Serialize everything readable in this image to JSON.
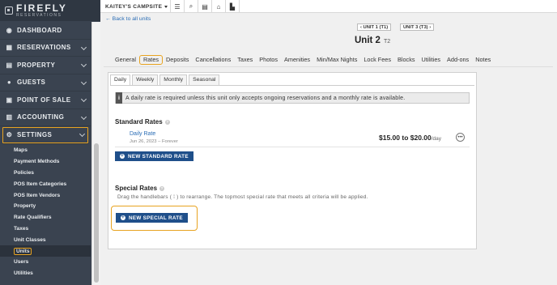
{
  "logo": {
    "name": "FIREFLY",
    "tagline": "RESERVATIONS"
  },
  "nav": [
    {
      "label": "DASHBOARD",
      "icon": "dashboard-icon",
      "glyph": "◉",
      "chevron": false
    },
    {
      "label": "RESERVATIONS",
      "icon": "calendar-icon",
      "glyph": "▦",
      "chevron": true
    },
    {
      "label": "PROPERTY",
      "icon": "building-icon",
      "glyph": "▤",
      "chevron": true
    },
    {
      "label": "GUESTS",
      "icon": "user-icon",
      "glyph": "●",
      "chevron": true
    },
    {
      "label": "POINT OF SALE",
      "icon": "cart-icon",
      "glyph": "▣",
      "chevron": true
    },
    {
      "label": "ACCOUNTING",
      "icon": "calculator-icon",
      "glyph": "▥",
      "chevron": true
    },
    {
      "label": "SETTINGS",
      "icon": "gear-icon",
      "glyph": "⚙",
      "chevron": true
    }
  ],
  "subnav": [
    "Maps",
    "Payment Methods",
    "Policies",
    "POS Item Categories",
    "POS Item Vendors",
    "Property",
    "Rate Qualifiers",
    "Taxes",
    "Unit Classes",
    "Units",
    "Users",
    "Utilities"
  ],
  "topbar": {
    "campsite": "KAITEY'S CAMPSITE",
    "icons": [
      {
        "name": "list-icon",
        "glyph": "☰"
      },
      {
        "name": "search-icon",
        "glyph": "⌕"
      },
      {
        "name": "clipboard-icon",
        "glyph": "▤"
      },
      {
        "name": "home-icon",
        "glyph": "⌂"
      },
      {
        "name": "store-icon",
        "glyph": "▙"
      }
    ]
  },
  "back_link": "← Back to all units",
  "unit_nav": {
    "prev": "‹ UNIT 1 (T1)",
    "next": "UNIT 3 (T3) ›"
  },
  "unit": {
    "title": "Unit 2",
    "code": "T2"
  },
  "tabs": [
    "General",
    "Rates",
    "Deposits",
    "Cancellations",
    "Taxes",
    "Photos",
    "Amenities",
    "Min/Max Nights",
    "Lock Fees",
    "Blocks",
    "Utilities",
    "Add-ons",
    "Notes"
  ],
  "subtabs": [
    "Daily",
    "Weekly",
    "Monthly",
    "Seasonal"
  ],
  "info": "A daily rate is required unless this unit only accepts ongoing reservations and a monthly rate is available.",
  "standard": {
    "title": "Standard Rates",
    "rate_name": "Daily Rate",
    "rate_dates": "Jun 26, 2023 – Forever",
    "rate_amount": "$15.00 to $20.00",
    "rate_per": "/day",
    "button": "NEW STANDARD RATE"
  },
  "special": {
    "title": "Special Rates",
    "help": "Drag the handlebars ( ⁞ ) to rearrange. The topmost special rate that meets all criteria will be applied.",
    "button": "NEW SPECIAL RATE"
  },
  "colors": {
    "sidebar": "#3a4350",
    "accent": "#e8a320",
    "primary": "#1f4f8a",
    "link": "#2a6db5"
  }
}
